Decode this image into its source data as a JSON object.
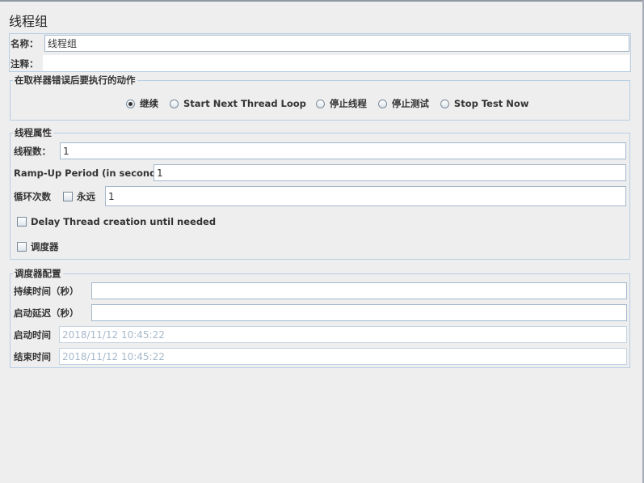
{
  "page_title": "线程组",
  "name_field": {
    "label": "名称：",
    "value": "线程组"
  },
  "comment_field": {
    "label": "注释：",
    "value": ""
  },
  "sampler_error": {
    "legend": "在取样器错误后要执行的动作",
    "options": [
      {
        "label": "继续",
        "checked": true
      },
      {
        "label": "Start Next Thread Loop",
        "checked": false
      },
      {
        "label": "停止线程",
        "checked": false
      },
      {
        "label": "停止测试",
        "checked": false
      },
      {
        "label": "Stop Test Now",
        "checked": false
      }
    ]
  },
  "thread_props": {
    "legend": "线程属性",
    "num_threads_label": "线程数：",
    "num_threads_value": "1",
    "rampup_label": "Ramp-Up Period (in seconds):",
    "rampup_value": "1",
    "loop_label": "循环次数",
    "forever_label": "永远",
    "forever_checked": false,
    "loop_value": "1",
    "delay_label": "Delay Thread creation until needed",
    "delay_checked": false,
    "scheduler_label": "调度器",
    "scheduler_checked": false
  },
  "scheduler_config": {
    "legend": "调度器配置",
    "duration_label": "持续时间（秒）",
    "duration_value": "",
    "startup_delay_label": "启动延迟（秒）",
    "startup_delay_value": "",
    "start_time_label": "启动时间",
    "start_time_value": "2018/11/12 10:45:22",
    "end_time_label": "结束时间",
    "end_time_value": "2018/11/12 10:45:22"
  },
  "colors": {
    "background": "#eeeeee",
    "border": "#b8cfe5",
    "disabled_text": "#a6b8ca"
  }
}
